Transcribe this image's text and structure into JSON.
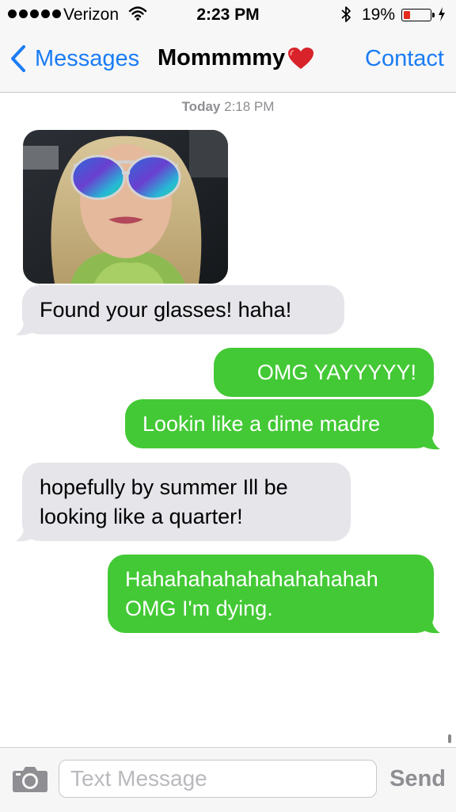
{
  "status_bar": {
    "carrier": "Verizon",
    "time": "2:23 PM",
    "battery_percent": "19%",
    "battery_level": 0.19,
    "signal_bars": 5,
    "icons": [
      "signal-dots-icon",
      "wifi-icon",
      "bluetooth-icon",
      "battery-icon",
      "charging-bolt-icon"
    ]
  },
  "nav": {
    "back_label": "Messages",
    "title": "Mommmmy",
    "title_emoji": "heart-emoji",
    "contact_label": "Contact"
  },
  "thread": {
    "timestamp_day": "Today",
    "timestamp_time": "2:18 PM",
    "messages": [
      {
        "sender": "them",
        "type": "image",
        "description": "photo"
      },
      {
        "sender": "them",
        "type": "text",
        "lines": [
          "Found your glasses! haha!"
        ]
      },
      {
        "sender": "me",
        "type": "text",
        "lines": [
          "OMG YAYYYYY!"
        ]
      },
      {
        "sender": "me",
        "type": "text",
        "lines": [
          "Lookin like a dime madre"
        ]
      },
      {
        "sender": "them",
        "type": "text",
        "lines": [
          "hopefully by summer Ill be",
          "looking like a quarter!"
        ]
      },
      {
        "sender": "me",
        "type": "text",
        "lines": [
          "Hahahahahahahahahahah",
          "OMG I'm dying."
        ]
      }
    ]
  },
  "composer": {
    "placeholder": "Text Message",
    "send_label": "Send",
    "camera_icon": "camera-icon"
  },
  "colors": {
    "accent_blue": "#1a7cf5",
    "outgoing_green": "#43c935",
    "incoming_gray": "#e5e5ea",
    "battery_red": "#e52a1e"
  }
}
